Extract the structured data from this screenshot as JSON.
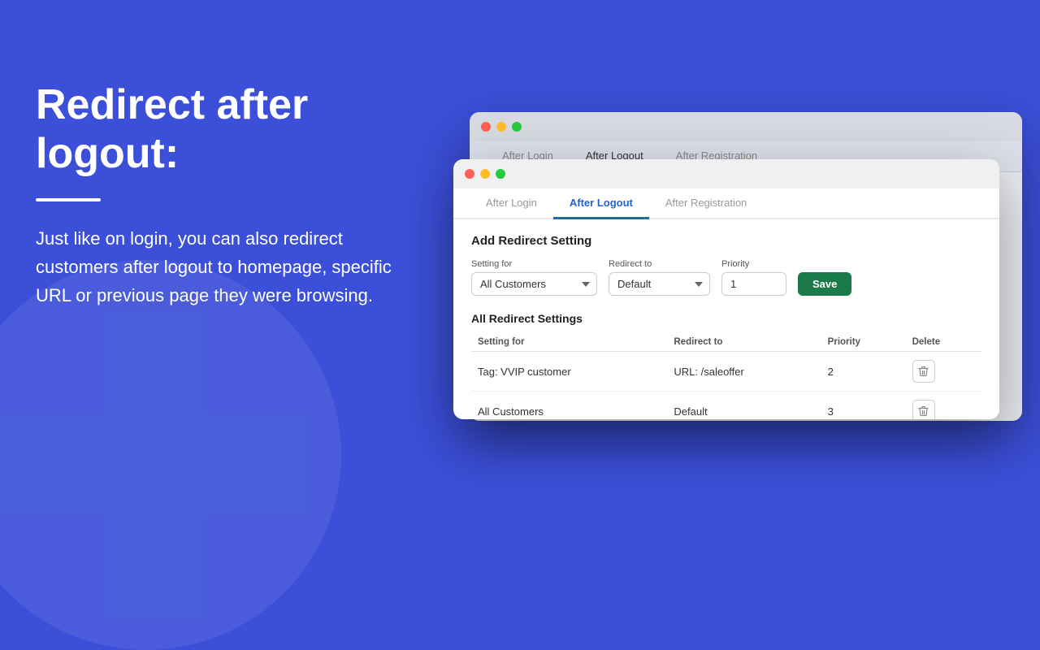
{
  "background": {
    "color": "#3b4fd8"
  },
  "left": {
    "title": "Redirect after logout:",
    "divider": true,
    "description": "Just like on login, you can also redirect customers after logout to homepage, specific URL or previous page they were browsing."
  },
  "window_back": {
    "tabs": [
      {
        "label": "After Login",
        "active": false
      },
      {
        "label": "After Logout",
        "active": true
      },
      {
        "label": "After Registration",
        "active": false
      }
    ]
  },
  "window_front": {
    "tabs": [
      {
        "label": "After Login",
        "active": false
      },
      {
        "label": "After Logout",
        "active": true
      },
      {
        "label": "After Registration",
        "active": false
      }
    ],
    "form": {
      "title": "Add Redirect Setting",
      "setting_for_label": "Setting for",
      "setting_for_value": "All Customers",
      "redirect_to_label": "Redirect to",
      "redirect_to_value": "Default",
      "priority_label": "Priority",
      "priority_value": "1",
      "save_label": "Save"
    },
    "table": {
      "title": "All Redirect Settings",
      "columns": [
        "Setting for",
        "Redirect to",
        "Priority",
        "Delete"
      ],
      "rows": [
        {
          "setting_for": "Tag: VVIP customer",
          "redirect_to": "URL: /saleoffer",
          "priority": "2"
        },
        {
          "setting_for": "All Customers",
          "redirect_to": "Default",
          "priority": "3"
        }
      ]
    }
  }
}
